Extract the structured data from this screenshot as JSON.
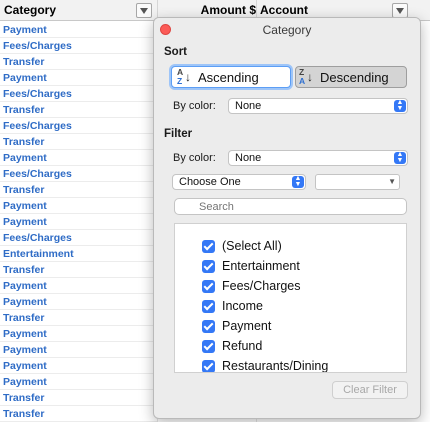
{
  "columns": {
    "category": "Category",
    "amount": "Amount $",
    "account": "Account"
  },
  "rows": [
    "Payment",
    "Fees/Charges",
    "Transfer",
    "Payment",
    "Fees/Charges",
    "Transfer",
    "Fees/Charges",
    "Transfer",
    "Payment",
    "Fees/Charges",
    "Transfer",
    "Payment",
    "Payment",
    "Fees/Charges",
    "Entertainment",
    "Transfer",
    "Payment",
    "Payment",
    "Transfer",
    "Payment",
    "Payment",
    "Payment",
    "Payment",
    "Transfer",
    "Transfer"
  ],
  "popup": {
    "title": "Category",
    "sort_label": "Sort",
    "ascending": "Ascending",
    "descending": "Descending",
    "az_top": "A",
    "az_bottom": "Z",
    "za_top": "Z",
    "za_bottom": "A",
    "sort_by_color_label": "By color:",
    "sort_by_color_value": "None",
    "filter_label": "Filter",
    "filter_by_color_label": "By color:",
    "filter_by_color_value": "None",
    "condition_value": "Choose One",
    "search_placeholder": "Search",
    "items": [
      {
        "label": "(Select All)",
        "checked": true
      },
      {
        "label": "Entertainment",
        "checked": true
      },
      {
        "label": "Fees/Charges",
        "checked": true
      },
      {
        "label": "Income",
        "checked": true
      },
      {
        "label": "Payment",
        "checked": true
      },
      {
        "label": "Refund",
        "checked": true
      },
      {
        "label": "Restaurants/Dining",
        "checked": true
      }
    ],
    "clear_filter": "Clear Filter"
  },
  "colors": {
    "row_text": "#2f6cc6",
    "accent": "#3478f6",
    "close": "#fc5b57"
  },
  "icons": [
    "dropdown-arrow-icon",
    "sort-az-icon",
    "sort-za-icon",
    "chevron-updown-icon",
    "search-icon",
    "checkbox-checked-icon",
    "close-icon"
  ]
}
